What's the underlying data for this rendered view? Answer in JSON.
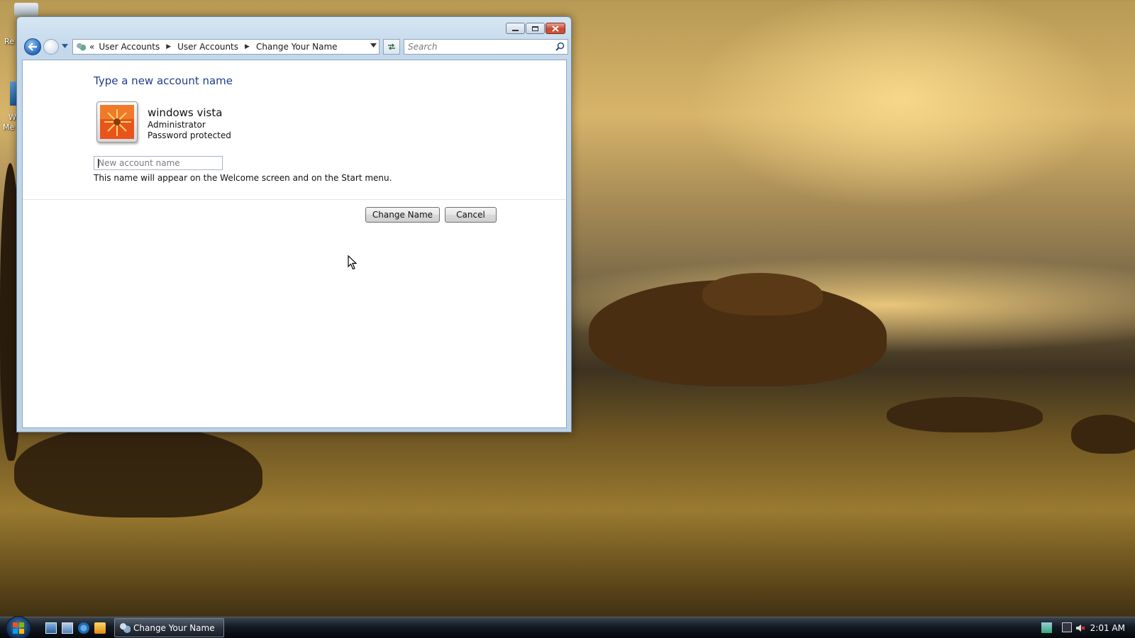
{
  "desktop": {
    "icons": [
      {
        "label_fragment": "Re"
      },
      {
        "label_fragment": "W"
      },
      {
        "label_fragment": "Me"
      }
    ]
  },
  "window": {
    "address": {
      "chevron": "«",
      "crumbs": [
        "User Accounts",
        "User Accounts",
        "Change Your Name"
      ]
    },
    "search": {
      "placeholder": "Search"
    },
    "heading": "Type a new account name",
    "user": {
      "name": "windows vista",
      "role": "Administrator",
      "status": "Password protected"
    },
    "input": {
      "placeholder": "New account name",
      "value": ""
    },
    "hint": "This name will appear on the Welcome screen and on the Start menu.",
    "buttons": {
      "change": "Change Name",
      "cancel": "Cancel"
    }
  },
  "taskbar": {
    "task_label": "Change Your Name",
    "clock": "2:01 AM"
  },
  "colors": {
    "heading_blue": "#1e3e8a",
    "close_red": "#c74a34"
  }
}
